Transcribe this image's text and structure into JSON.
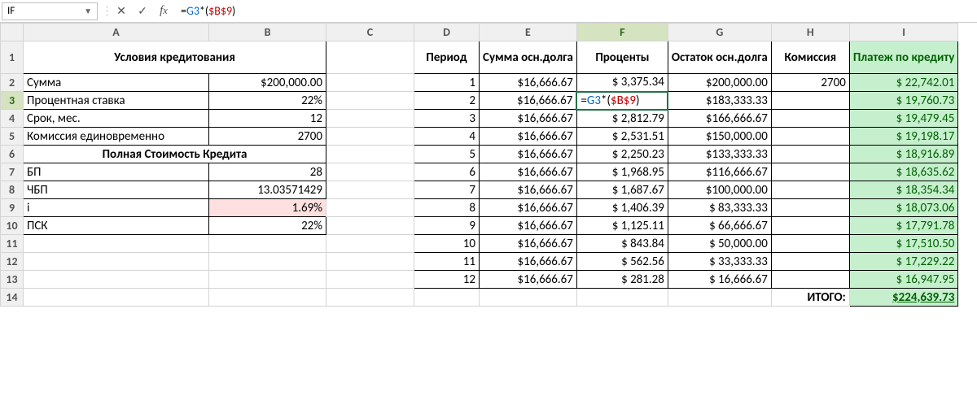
{
  "namebox": "IF",
  "formula": {
    "prefix": "=",
    "ref1": "G3",
    "mid": "*(",
    "ref2": "$B$9",
    "suffix": ")"
  },
  "columns": [
    "A",
    "B",
    "C",
    "D",
    "E",
    "F",
    "G",
    "H",
    "I"
  ],
  "rows": [
    "1",
    "2",
    "3",
    "4",
    "5",
    "6",
    "7",
    "8",
    "9",
    "10",
    "11",
    "12",
    "13",
    "14"
  ],
  "active_col": "F",
  "active_row": "3",
  "left": {
    "header": "Условия кредитования",
    "r2": {
      "label": "Сумма",
      "val": "$200,000.00"
    },
    "r3": {
      "label": "Процентная ставка",
      "val": "22%"
    },
    "r4": {
      "label": "Срок, мес.",
      "val": "12"
    },
    "r5": {
      "label": "Комиссия единовременно",
      "val": "2700"
    },
    "header2": "Полная Стоимость Кредита",
    "r7": {
      "label": "БП",
      "val": "28"
    },
    "r8": {
      "label": "ЧБП",
      "val": "13.03571429"
    },
    "r9": {
      "label": "i",
      "val": "1.69%"
    },
    "r10": {
      "label": "ПСК",
      "val": "22%"
    }
  },
  "hdr": {
    "D": "Период",
    "E": "Сумма осн.долга",
    "F": "Проценты",
    "G": "Остаток осн.долга",
    "H": "Комиссия",
    "I": "Платеж по кредиту"
  },
  "data": [
    {
      "n": "1",
      "e": "$16,666.67",
      "f": "$  3,375.34",
      "g": "$200,000.00",
      "h": "2700",
      "i": "$  22,742.01"
    },
    {
      "n": "2",
      "e": "$16,666.67",
      "f": "=G3*($B$9)",
      "g": "$183,333.33",
      "h": "",
      "i": "$  19,760.73"
    },
    {
      "n": "3",
      "e": "$16,666.67",
      "f": "$  2,812.79",
      "g": "$166,666.67",
      "h": "",
      "i": "$  19,479.45"
    },
    {
      "n": "4",
      "e": "$16,666.67",
      "f": "$  2,531.51",
      "g": "$150,000.00",
      "h": "",
      "i": "$  19,198.17"
    },
    {
      "n": "5",
      "e": "$16,666.67",
      "f": "$  2,250.23",
      "g": "$133,333.33",
      "h": "",
      "i": "$  18,916.89"
    },
    {
      "n": "6",
      "e": "$16,666.67",
      "f": "$  1,968.95",
      "g": "$116,666.67",
      "h": "",
      "i": "$  18,635.62"
    },
    {
      "n": "7",
      "e": "$16,666.67",
      "f": "$  1,687.67",
      "g": "$100,000.00",
      "h": "",
      "i": "$  18,354.34"
    },
    {
      "n": "8",
      "e": "$16,666.67",
      "f": "$  1,406.39",
      "g": "$  83,333.33",
      "h": "",
      "i": "$  18,073.06"
    },
    {
      "n": "9",
      "e": "$16,666.67",
      "f": "$  1,125.11",
      "g": "$  66,666.67",
      "h": "",
      "i": "$  17,791.78"
    },
    {
      "n": "10",
      "e": "$16,666.67",
      "f": "$     843.84",
      "g": "$  50,000.00",
      "h": "",
      "i": "$  17,510.50"
    },
    {
      "n": "11",
      "e": "$16,666.67",
      "f": "$     562.56",
      "g": "$  33,333.33",
      "h": "",
      "i": "$  17,229.22"
    },
    {
      "n": "12",
      "e": "$16,666.67",
      "f": "$     281.28",
      "g": "$  16,666.67",
      "h": "",
      "i": "$  16,947.95"
    }
  ],
  "total": {
    "label": "ИТОГО:",
    "val": "$224,639.73"
  },
  "chart_data": {
    "type": "table",
    "title": "Loan amortization schedule (differentiated payments)",
    "loan": {
      "principal": 200000,
      "annual_rate_pct": 22,
      "term_months": 12,
      "one_time_fee": 2700
    },
    "psk": {
      "BP": 28,
      "ChBP": 13.03571429,
      "i_pct": 1.69,
      "PSK_pct": 22
    },
    "columns": [
      "Период",
      "Сумма осн.долга",
      "Проценты",
      "Остаток осн.долга",
      "Комиссия",
      "Платеж по кредиту"
    ],
    "rows": [
      [
        1,
        16666.67,
        3375.34,
        200000.0,
        2700,
        22742.01
      ],
      [
        2,
        16666.67,
        null,
        183333.33,
        null,
        19760.73
      ],
      [
        3,
        16666.67,
        2812.79,
        166666.67,
        null,
        19479.45
      ],
      [
        4,
        16666.67,
        2531.51,
        150000.0,
        null,
        19198.17
      ],
      [
        5,
        16666.67,
        2250.23,
        133333.33,
        null,
        18916.89
      ],
      [
        6,
        16666.67,
        1968.95,
        116666.67,
        null,
        18635.62
      ],
      [
        7,
        16666.67,
        1687.67,
        100000.0,
        null,
        18354.34
      ],
      [
        8,
        16666.67,
        1406.39,
        83333.33,
        null,
        18073.06
      ],
      [
        9,
        16666.67,
        1125.11,
        66666.67,
        null,
        17791.78
      ],
      [
        10,
        16666.67,
        843.84,
        50000.0,
        null,
        17510.5
      ],
      [
        11,
        16666.67,
        562.56,
        33333.33,
        null,
        17229.22
      ],
      [
        12,
        16666.67,
        281.28,
        16666.67,
        null,
        16947.95
      ]
    ],
    "total_payment": 224639.73,
    "editing_cell": {
      "address": "F3",
      "formula": "=G3*($B$9)"
    }
  }
}
